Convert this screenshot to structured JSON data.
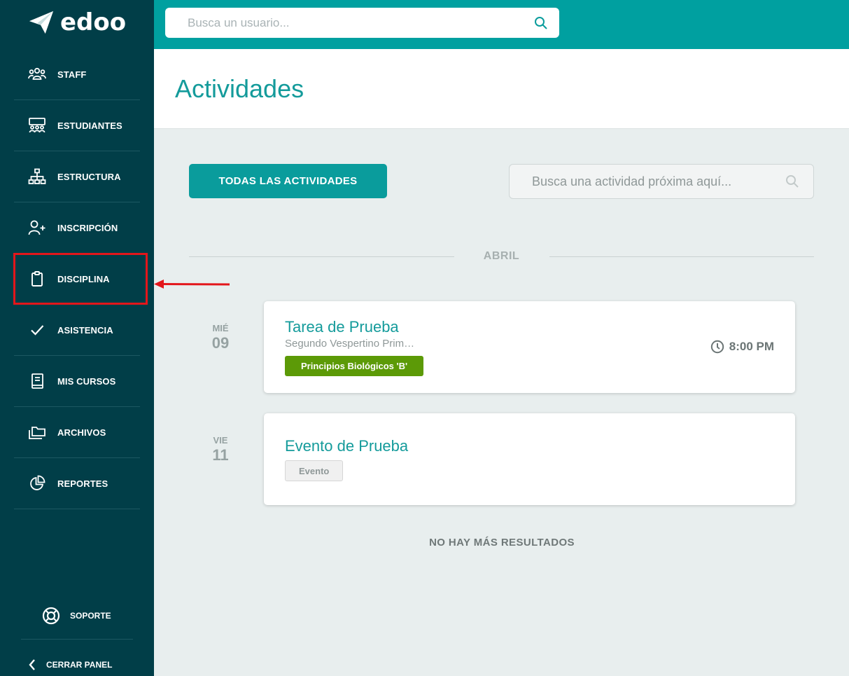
{
  "app": {
    "brand": "edoo"
  },
  "sidebar": {
    "items": [
      {
        "label": "STAFF",
        "icon": "staff-icon"
      },
      {
        "label": "ESTUDIANTES",
        "icon": "students-icon"
      },
      {
        "label": "ESTRUCTURA",
        "icon": "structure-icon"
      },
      {
        "label": "INSCRIPCIÓN",
        "icon": "add-user-icon"
      },
      {
        "label": "DISCIPLINA",
        "icon": "clipboard-icon"
      },
      {
        "label": "ASISTENCIA",
        "icon": "checkmark-icon"
      },
      {
        "label": "MIS CURSOS",
        "icon": "book-icon"
      },
      {
        "label": "ARCHIVOS",
        "icon": "folder-icon"
      },
      {
        "label": "REPORTES",
        "icon": "pie-chart-icon"
      }
    ],
    "support_label": "SOPORTE",
    "close_label": "CERRAR PANEL"
  },
  "topbar": {
    "user_search_placeholder": "Busca un usuario..."
  },
  "page": {
    "title": "Actividades"
  },
  "controls": {
    "all_activities_label": "TODAS LAS ACTIVIDADES",
    "activity_search_placeholder": "Busca una actividad próxima aquí..."
  },
  "month": "ABRIL",
  "activities": [
    {
      "dow": "MIÉ",
      "day": "09",
      "title": "Tarea de Prueba",
      "subtitle": "Segundo Vespertino Primaria",
      "tag": "Principios Biológicos 'B'",
      "time": "8:00 PM"
    },
    {
      "dow": "VIE",
      "day": "11",
      "title": "Evento de Prueba",
      "tag": "Evento"
    }
  ],
  "footer": {
    "no_more": "NO HAY MÁS RESULTADOS"
  },
  "colors": {
    "sidebar_bg": "#013e48",
    "topbar_bg": "#00a0a0",
    "accent": "#149b9b",
    "tag_green": "#5c9a07",
    "highlight": "#e3161b"
  }
}
